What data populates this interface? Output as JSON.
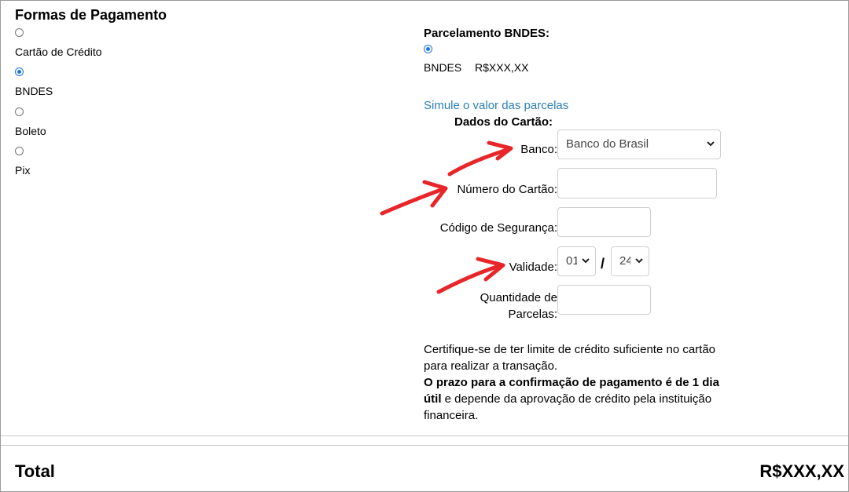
{
  "payment": {
    "title": "Formas de Pagamento",
    "options": [
      {
        "label": "Cartão de Crédito",
        "checked": false
      },
      {
        "label": "BNDES",
        "checked": true
      },
      {
        "label": "Boleto",
        "checked": false
      },
      {
        "label": "Pix",
        "checked": false
      }
    ]
  },
  "bndes": {
    "heading": "Parcelamento BNDES:",
    "option_label": "BNDES",
    "option_value": "R$XXX,XX",
    "simulate_link": "Simule o valor das parcelas"
  },
  "card": {
    "heading": "Dados do Cartão:",
    "bank_label": "Banco:",
    "bank_value": "Banco do Brasil",
    "number_label": "Número do Cartão:",
    "security_label": "Código de Segurança:",
    "validity_label": "Validade:",
    "month_value": "01",
    "slash": "/",
    "year_value": "24",
    "installments_label_1": "Quantidade de",
    "installments_label_2": "Parcelas:"
  },
  "notice": {
    "line1": "Certifique-se de ter limite de crédito suficiente no cartão",
    "line2": "para realizar a transação.",
    "bold_part": "O prazo para a confirmação de pagamento é de 1 dia útil",
    "rest_part": " e depende da aprovação de crédito pela instituição financeira."
  },
  "footer": {
    "total_label": "Total",
    "total_value": "R$XXX,XX"
  },
  "colors": {
    "accent": "#1a73e8",
    "link": "#2c7fb8",
    "annotation_arrow": "#e8262a"
  }
}
